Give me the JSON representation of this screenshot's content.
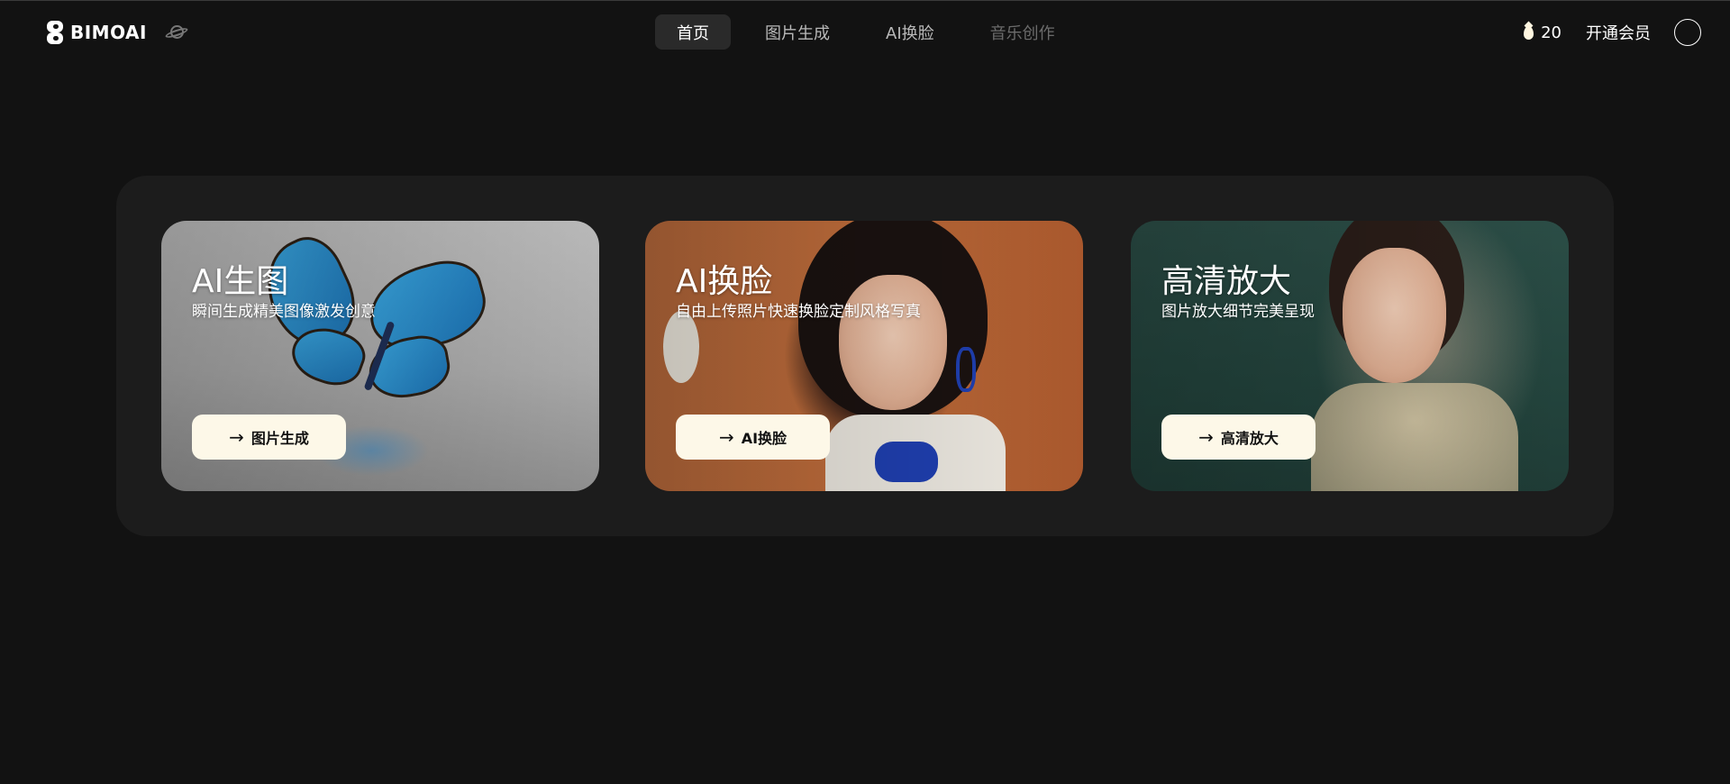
{
  "header": {
    "brand": "BIMOAI",
    "nav": [
      {
        "label": "首页",
        "state": "active"
      },
      {
        "label": "图片生成",
        "state": "normal"
      },
      {
        "label": "AI换脸",
        "state": "normal"
      },
      {
        "label": "音乐创作",
        "state": "disabled"
      }
    ],
    "credits": "20",
    "vip_label": "开通会员"
  },
  "cards": [
    {
      "title": "AI生图",
      "subtitle": "瞬间生成精美图像激发创意",
      "button_label": "图片生成",
      "image": "blue-butterfly-photo"
    },
    {
      "title": "AI换脸",
      "subtitle": "自由上传照片快速换脸定制风格写真",
      "button_label": "AI换脸",
      "image": "woman-orange-background-photo"
    },
    {
      "title": "高清放大",
      "subtitle": "图片放大细节完美呈现",
      "button_label": "高清放大",
      "image": "woman-underwater-photo"
    }
  ],
  "icons": {
    "arrow": "→",
    "credit": "drop-icon",
    "planet": "planet-icon"
  },
  "colors": {
    "background": "#121212",
    "panel": "#1c1c1c",
    "button": "#fdf8e8",
    "nav_active": "#2a2a2a"
  }
}
